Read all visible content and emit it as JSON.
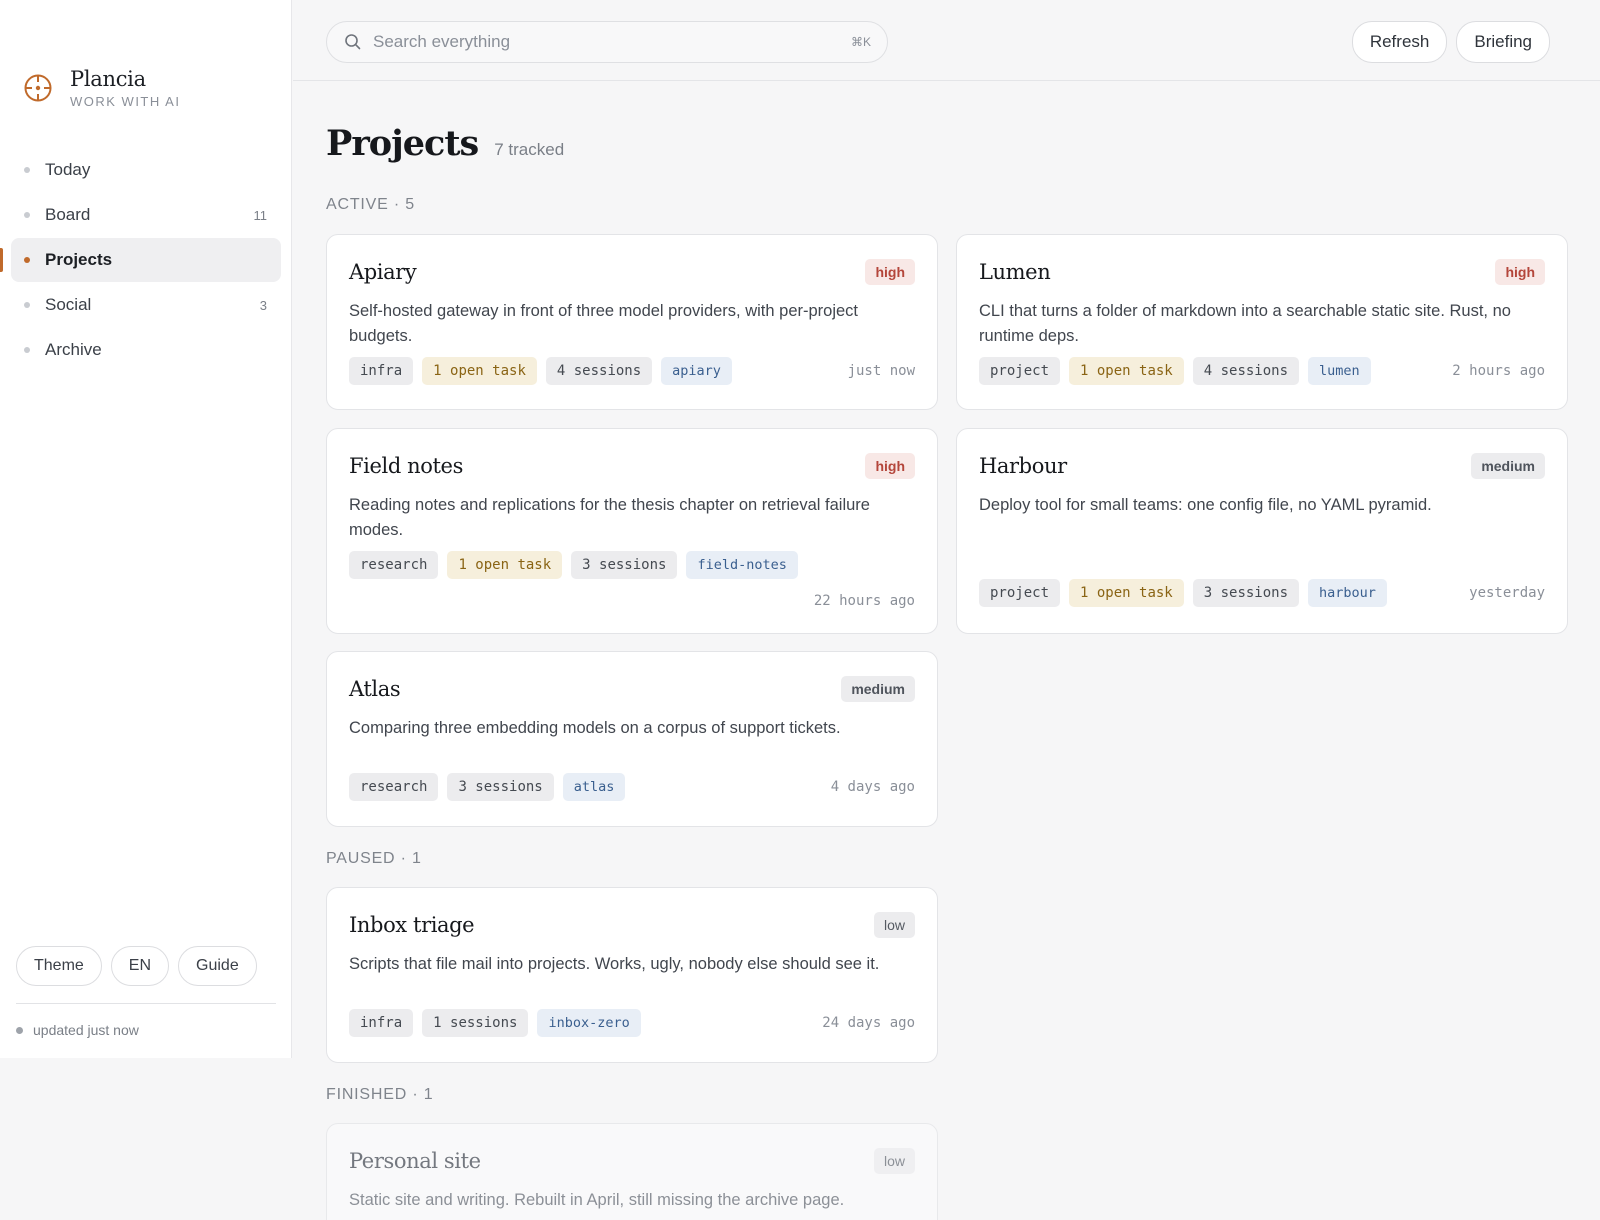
{
  "brand": {
    "name": "Plancia",
    "tagline": "WORK WITH AI",
    "accent": "#c06a2b",
    "icon": "crosshair-icon"
  },
  "nav": [
    {
      "label": "Today",
      "count": ""
    },
    {
      "label": "Board",
      "count": "11"
    },
    {
      "label": "Projects",
      "count": "",
      "active": true
    },
    {
      "label": "Social",
      "count": "3"
    },
    {
      "label": "Archive",
      "count": ""
    }
  ],
  "footer": {
    "theme": "Theme",
    "lang": "EN",
    "guide": "Guide",
    "status": "updated just now"
  },
  "search": {
    "placeholder": "Search everything",
    "shortcut": "⌘K",
    "icon": "search-icon"
  },
  "actions": {
    "refresh": "Refresh",
    "briefing": "Briefing"
  },
  "page": {
    "title": "Projects",
    "subtitle": "7 tracked"
  },
  "sections": {
    "active": "ACTIVE · 5",
    "paused": "PAUSED · 1",
    "finished": "FINISHED · 1"
  },
  "projects": [
    {
      "title": "Apiary",
      "priority": "high",
      "desc": "Self-hosted gateway in front of three model providers, with per-project budgets.",
      "kind": "infra",
      "tasks": "1 open task",
      "sessions": "4 sessions",
      "slug": "apiary",
      "ago": "just now"
    },
    {
      "title": "Lumen",
      "priority": "high",
      "desc": "CLI that turns a folder of markdown into a searchable static site. Rust, no runtime deps.",
      "kind": "project",
      "tasks": "1 open task",
      "sessions": "4 sessions",
      "slug": "lumen",
      "ago": "2 hours ago"
    },
    {
      "title": "Field notes",
      "priority": "high",
      "desc": "Reading notes and replications for the thesis chapter on retrieval failure modes.",
      "kind": "research",
      "tasks": "1 open task",
      "sessions": "3 sessions",
      "slug": "field-notes",
      "ago": "22 hours ago"
    },
    {
      "title": "Harbour",
      "priority": "medium",
      "desc": "Deploy tool for small teams: one config file, no YAML pyramid.",
      "kind": "project",
      "tasks": "1 open task",
      "sessions": "3 sessions",
      "slug": "harbour",
      "ago": "yesterday"
    },
    {
      "title": "Atlas",
      "priority": "medium",
      "desc": "Comparing three embedding models on a corpus of support tickets.",
      "kind": "research",
      "tasks": "",
      "sessions": "3 sessions",
      "slug": "atlas",
      "ago": "4 days ago"
    },
    {
      "title": "Inbox triage",
      "priority": "low",
      "desc": "Scripts that file mail into projects. Works, ugly, nobody else should see it.",
      "kind": "infra",
      "tasks": "",
      "sessions": "1 sessions",
      "slug": "inbox-zero",
      "ago": "24 days ago"
    },
    {
      "title": "Personal site",
      "priority": "low",
      "desc": "Static site and writing. Rebuilt in April, still missing the archive page."
    }
  ]
}
